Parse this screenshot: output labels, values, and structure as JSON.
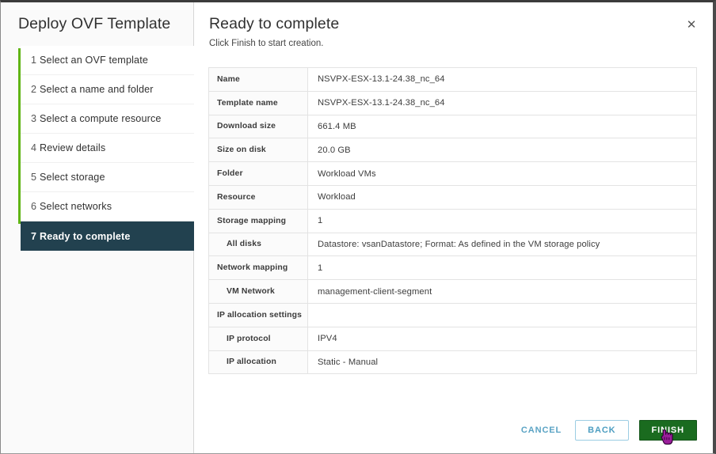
{
  "window": {
    "wizard_title": "Deploy OVF Template"
  },
  "sidebar": {
    "steps": [
      {
        "num": "1",
        "label": "Select an OVF template",
        "selected": false
      },
      {
        "num": "2",
        "label": "Select a name and folder",
        "selected": false
      },
      {
        "num": "3",
        "label": "Select a compute resource",
        "selected": false
      },
      {
        "num": "4",
        "label": "Review details",
        "selected": false
      },
      {
        "num": "5",
        "label": "Select storage",
        "selected": false
      },
      {
        "num": "6",
        "label": "Select networks",
        "selected": false
      },
      {
        "num": "7",
        "label": "Ready to complete",
        "selected": true
      }
    ],
    "rail_color": "#60b515",
    "selected_color": "#22414f"
  },
  "main": {
    "title": "Ready to complete",
    "subtitle": "Click Finish to start creation.",
    "close_icon": "close-icon",
    "summary_rows": [
      {
        "key": "Name",
        "value": "NSVPX-ESX-13.1-24.38_nc_64",
        "sub": false
      },
      {
        "key": "Template name",
        "value": "NSVPX-ESX-13.1-24.38_nc_64",
        "sub": false
      },
      {
        "key": "Download size",
        "value": "661.4 MB",
        "sub": false
      },
      {
        "key": "Size on disk",
        "value": "20.0 GB",
        "sub": false
      },
      {
        "key": "Folder",
        "value": "Workload VMs",
        "sub": false
      },
      {
        "key": "Resource",
        "value": "Workload",
        "sub": false
      },
      {
        "key": "Storage mapping",
        "value": "1",
        "sub": false
      },
      {
        "key": "All disks",
        "value": "Datastore: vsanDatastore; Format: As defined in the VM storage policy",
        "sub": true
      },
      {
        "key": "Network mapping",
        "value": "1",
        "sub": false
      },
      {
        "key": "VM Network",
        "value": "management-client-segment",
        "sub": true
      },
      {
        "key": "IP allocation settings",
        "value": "",
        "sub": false
      },
      {
        "key": "IP protocol",
        "value": "IPV4",
        "sub": true
      },
      {
        "key": "IP allocation",
        "value": "Static - Manual",
        "sub": true
      }
    ]
  },
  "footer": {
    "cancel_label": "CANCEL",
    "back_label": "BACK",
    "finish_label": "FINISH",
    "finish_color": "#1a6b1f",
    "link_color": "#5aa3c4"
  }
}
